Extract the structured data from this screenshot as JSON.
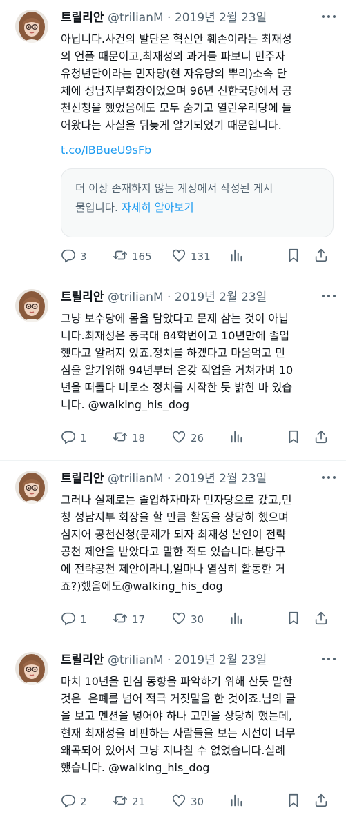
{
  "colors": {
    "link": "#1d9bf0",
    "text": "#0f1419",
    "secondary": "#536471"
  },
  "tweets": [
    {
      "name": "트릴리안",
      "handle": "@trilianM",
      "date": "2019년 2월 23일",
      "body": "아닙니다.사건의 발단은 혁신안 훼손이라는 최재성\n의 언플 때문이고,최재성의 과거를 파보니 민주자\n유청년단이라는 민자당(현 자유당의 뿌리)소속 단\n체에 성남지부회장이었으며 96년 신한국당에서 공\n천신청을 했었음에도 모두 숨기고 열린우리당에 들\n어왔다는 사실을 뒤늦게 알기되었기 때문입니다.",
      "link": "t.co/lBBueU9sFb",
      "notice_text": "더 이상 존재하지 않는 계정에서 작성된 게시\n물입니다.",
      "notice_link": "자세히 알아보기",
      "replies": "3",
      "retweets": "165",
      "likes": "131",
      "icons": {
        "reply": "reply-icon",
        "retweet": "retweet-icon",
        "like": "heart-icon",
        "views": "views-icon",
        "bookmark": "bookmark-icon",
        "share": "share-icon"
      }
    },
    {
      "name": "트릴리안",
      "handle": "@trilianM",
      "date": "2019년 2월 23일",
      "body": "그냥 보수당에 몸을 담았다고 문제 삼는 것이 아닙\n니다.최재성은 동국대 84학번이고 10년만에 졸업\n했다고 알려져 있죠.정치를 하겠다고 마음먹고 민\n심을 알기위해 94년부터 온갖 직업을 거쳐가며 10\n년을 떠돌다 비로소 정치를 시작한 듯 밝힌 바 있습\n니다. @walking_his_dog",
      "replies": "1",
      "retweets": "18",
      "likes": "26"
    },
    {
      "name": "트릴리안",
      "handle": "@trilianM",
      "date": "2019년 2월 23일",
      "body": "그러나 실제로는 졸업하자마자 민자당으로 갔고,민\n청 성남지부 회장을 할 만큼 활동을 상당히 했으며\n심지어 공천신청(문제가 되자 최재성 본인이 전략\n공천 제안을 받았다고 말한 적도 있습니다.분당구\n에 전략공천 제안이라니,얼마나 열심히 활동한 거\n죠?)했음에도@walking_his_dog",
      "replies": "1",
      "retweets": "17",
      "likes": "30"
    },
    {
      "name": "트릴리안",
      "handle": "@trilianM",
      "date": "2019년 2월 23일",
      "body": "마치 10년을 민심 동향을 파악하기 위해 산듯 말한\n것은  은폐를 넘어 적극 거짓말을 한 것이죠.님의 글\n을 보고 멘션을 넣어야 하나 고민을 상당히 했는데,\n현재 최재성을 비판하는 사람들을 보는 시선이 너무\n왜곡되어 있어서 그냥 지나칠 수 없었습니다.실례\n했습니다. @walking_his_dog",
      "replies": "2",
      "retweets": "21",
      "likes": "30"
    }
  ]
}
